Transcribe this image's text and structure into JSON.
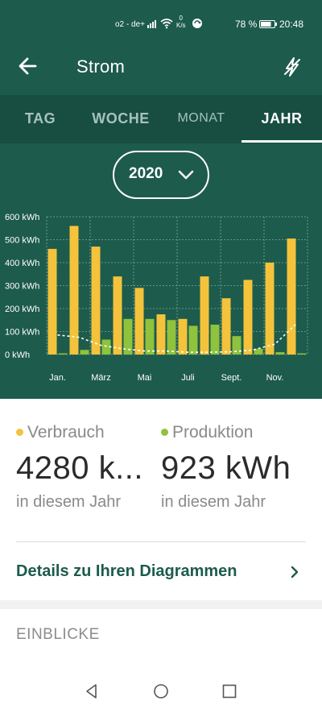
{
  "status_bar": {
    "carrier": "o2 - de+",
    "speed_value": "0",
    "speed_unit": "K/s",
    "battery_percent": "78 %",
    "time": "20:48",
    "icons": [
      "signal-icon",
      "wifi-icon",
      "sync-icon",
      "battery-icon"
    ]
  },
  "app_bar": {
    "title": "Strom",
    "back_icon": "arrow-left-icon",
    "action_icon": "lightning-off-icon"
  },
  "tabs": [
    {
      "label": "TAG",
      "active": false
    },
    {
      "label": "WOCHE",
      "active": false
    },
    {
      "label": "MONAT",
      "active": false
    },
    {
      "label": "JAHR",
      "active": true
    }
  ],
  "year_selector": {
    "value": "2020",
    "icon": "chevron-down-icon"
  },
  "colors": {
    "primary": "#1d5b4c",
    "tab_bar": "#174e41",
    "consumption": "#f4c33b",
    "production": "#8fc23d",
    "forecast_line": "#ffffff"
  },
  "chart_data": {
    "type": "bar",
    "unit": "kWh",
    "y_ticks": [
      "600 kWh",
      "500 kWh",
      "400 kWh",
      "300 kWh",
      "200 kWh",
      "100 kWh",
      "0 kWh"
    ],
    "ylim": [
      0,
      600
    ],
    "x_tick_labels": [
      "Jan.",
      "März",
      "Mai",
      "Juli",
      "Sept.",
      "Nov."
    ],
    "x_tick_months": [
      1,
      3,
      5,
      7,
      9,
      11
    ],
    "months": [
      1,
      2,
      3,
      4,
      5,
      6,
      7,
      8,
      9,
      10,
      11,
      12
    ],
    "series": [
      {
        "name": "Verbrauch",
        "values": [
          460,
          560,
          470,
          340,
          290,
          175,
          155,
          340,
          245,
          325,
          400,
          505
        ]
      },
      {
        "name": "Produktion",
        "values": [
          5,
          20,
          65,
          155,
          155,
          150,
          125,
          130,
          80,
          25,
          10,
          5
        ]
      },
      {
        "values": [
          85,
          75,
          40,
          25,
          15,
          15,
          10,
          10,
          12,
          20,
          45,
          135
        ],
        "style": "dashed"
      }
    ],
    "grid": true
  },
  "stats": {
    "consumption": {
      "label": "Verbrauch",
      "value": "4280 k...",
      "sub": "in diesem Jahr"
    },
    "production": {
      "label": "Produktion",
      "value": "923 kWh",
      "sub": "in diesem Jahr"
    }
  },
  "details_link": {
    "label": "Details zu Ihren Diagrammen",
    "icon": "chevron-right-icon"
  },
  "insights": {
    "title": "EINBLICKE"
  },
  "nav_bar": {
    "icons": [
      "nav-back-icon",
      "nav-home-icon",
      "nav-recents-icon"
    ]
  }
}
